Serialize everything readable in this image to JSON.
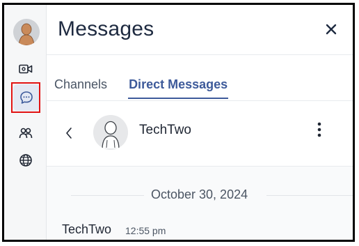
{
  "header": {
    "title": "Messages"
  },
  "tabs": [
    {
      "label": "Channels",
      "active": false
    },
    {
      "label": "Direct Messages",
      "active": true
    }
  ],
  "rail": {
    "items": [
      {
        "icon": "video-icon"
      },
      {
        "icon": "chat-icon",
        "active": true
      },
      {
        "icon": "people-icon"
      },
      {
        "icon": "globe-icon"
      }
    ]
  },
  "conversation": {
    "contact_name": "TechTwo",
    "date_separator": "October 30, 2024",
    "messages": [
      {
        "sender": "TechTwo",
        "time": "12:55 pm"
      }
    ]
  },
  "colors": {
    "accent": "#3d5a9a",
    "highlight": "#e11212",
    "title": "#1e2a40"
  }
}
